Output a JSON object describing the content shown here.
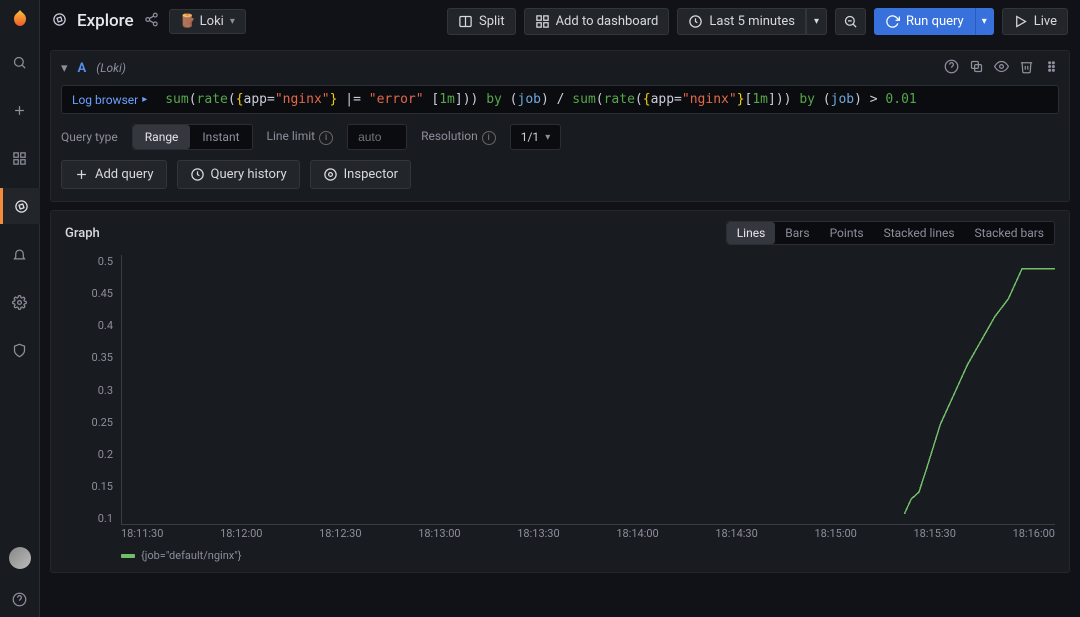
{
  "header": {
    "title": "Explore",
    "datasource": "Loki",
    "split": "Split",
    "add_to_dashboard": "Add to dashboard",
    "time_range": "Last 5 minutes",
    "run_query": "Run query",
    "live": "Live"
  },
  "query": {
    "ref": "A",
    "ds_label": "(Loki)",
    "log_browser": "Log browser",
    "expression_text": "sum(rate({app=\"nginx\"} |= \"error\" [1m])) by (job) / sum(rate({app=\"nginx\"}[1m])) by (job) > 0.01",
    "opts": {
      "query_type_label": "Query type",
      "range": "Range",
      "instant": "Instant",
      "line_limit_label": "Line limit",
      "line_limit_placeholder": "auto",
      "resolution_label": "Resolution",
      "resolution_value": "1/1"
    }
  },
  "actions": {
    "add_query": "Add query",
    "query_history": "Query history",
    "inspector": "Inspector"
  },
  "graph": {
    "title": "Graph",
    "viz_tabs": [
      "Lines",
      "Bars",
      "Points",
      "Stacked lines",
      "Stacked bars"
    ],
    "active_viz": "Lines",
    "legend": "{job=\"default/nginx\"}"
  },
  "chart_data": {
    "type": "line",
    "title": "",
    "xlabel": "",
    "ylabel": "",
    "ylim": [
      0.1,
      0.525
    ],
    "y_ticks": [
      0.5,
      0.45,
      0.4,
      0.35,
      0.3,
      0.25,
      0.2,
      0.15,
      0.1
    ],
    "x_ticks": [
      "18:11:30",
      "18:12:00",
      "18:12:30",
      "18:13:00",
      "18:13:30",
      "18:14:00",
      "18:14:30",
      "18:15:00",
      "18:15:30",
      "18:16:00"
    ],
    "series": [
      {
        "name": "{job=\"default/nginx\"}",
        "color": "#73bf69",
        "points": [
          {
            "x": "18:15:20",
            "y": 0.105
          },
          {
            "x": "18:15:22",
            "y": 0.13
          },
          {
            "x": "18:15:25",
            "y": 0.14
          },
          {
            "x": "18:15:28",
            "y": 0.18
          },
          {
            "x": "18:15:34",
            "y": 0.25
          },
          {
            "x": "18:15:40",
            "y": 0.3
          },
          {
            "x": "18:15:46",
            "y": 0.35
          },
          {
            "x": "18:15:52",
            "y": 0.39
          },
          {
            "x": "18:15:58",
            "y": 0.43
          },
          {
            "x": "18:16:04",
            "y": 0.46
          },
          {
            "x": "18:16:10",
            "y": 0.51
          },
          {
            "x": "18:16:20",
            "y": 0.51
          }
        ]
      }
    ]
  },
  "colors": {
    "accent_orange": "#f38b3c",
    "primary_blue": "#3871dc",
    "series_green": "#73bf69"
  }
}
